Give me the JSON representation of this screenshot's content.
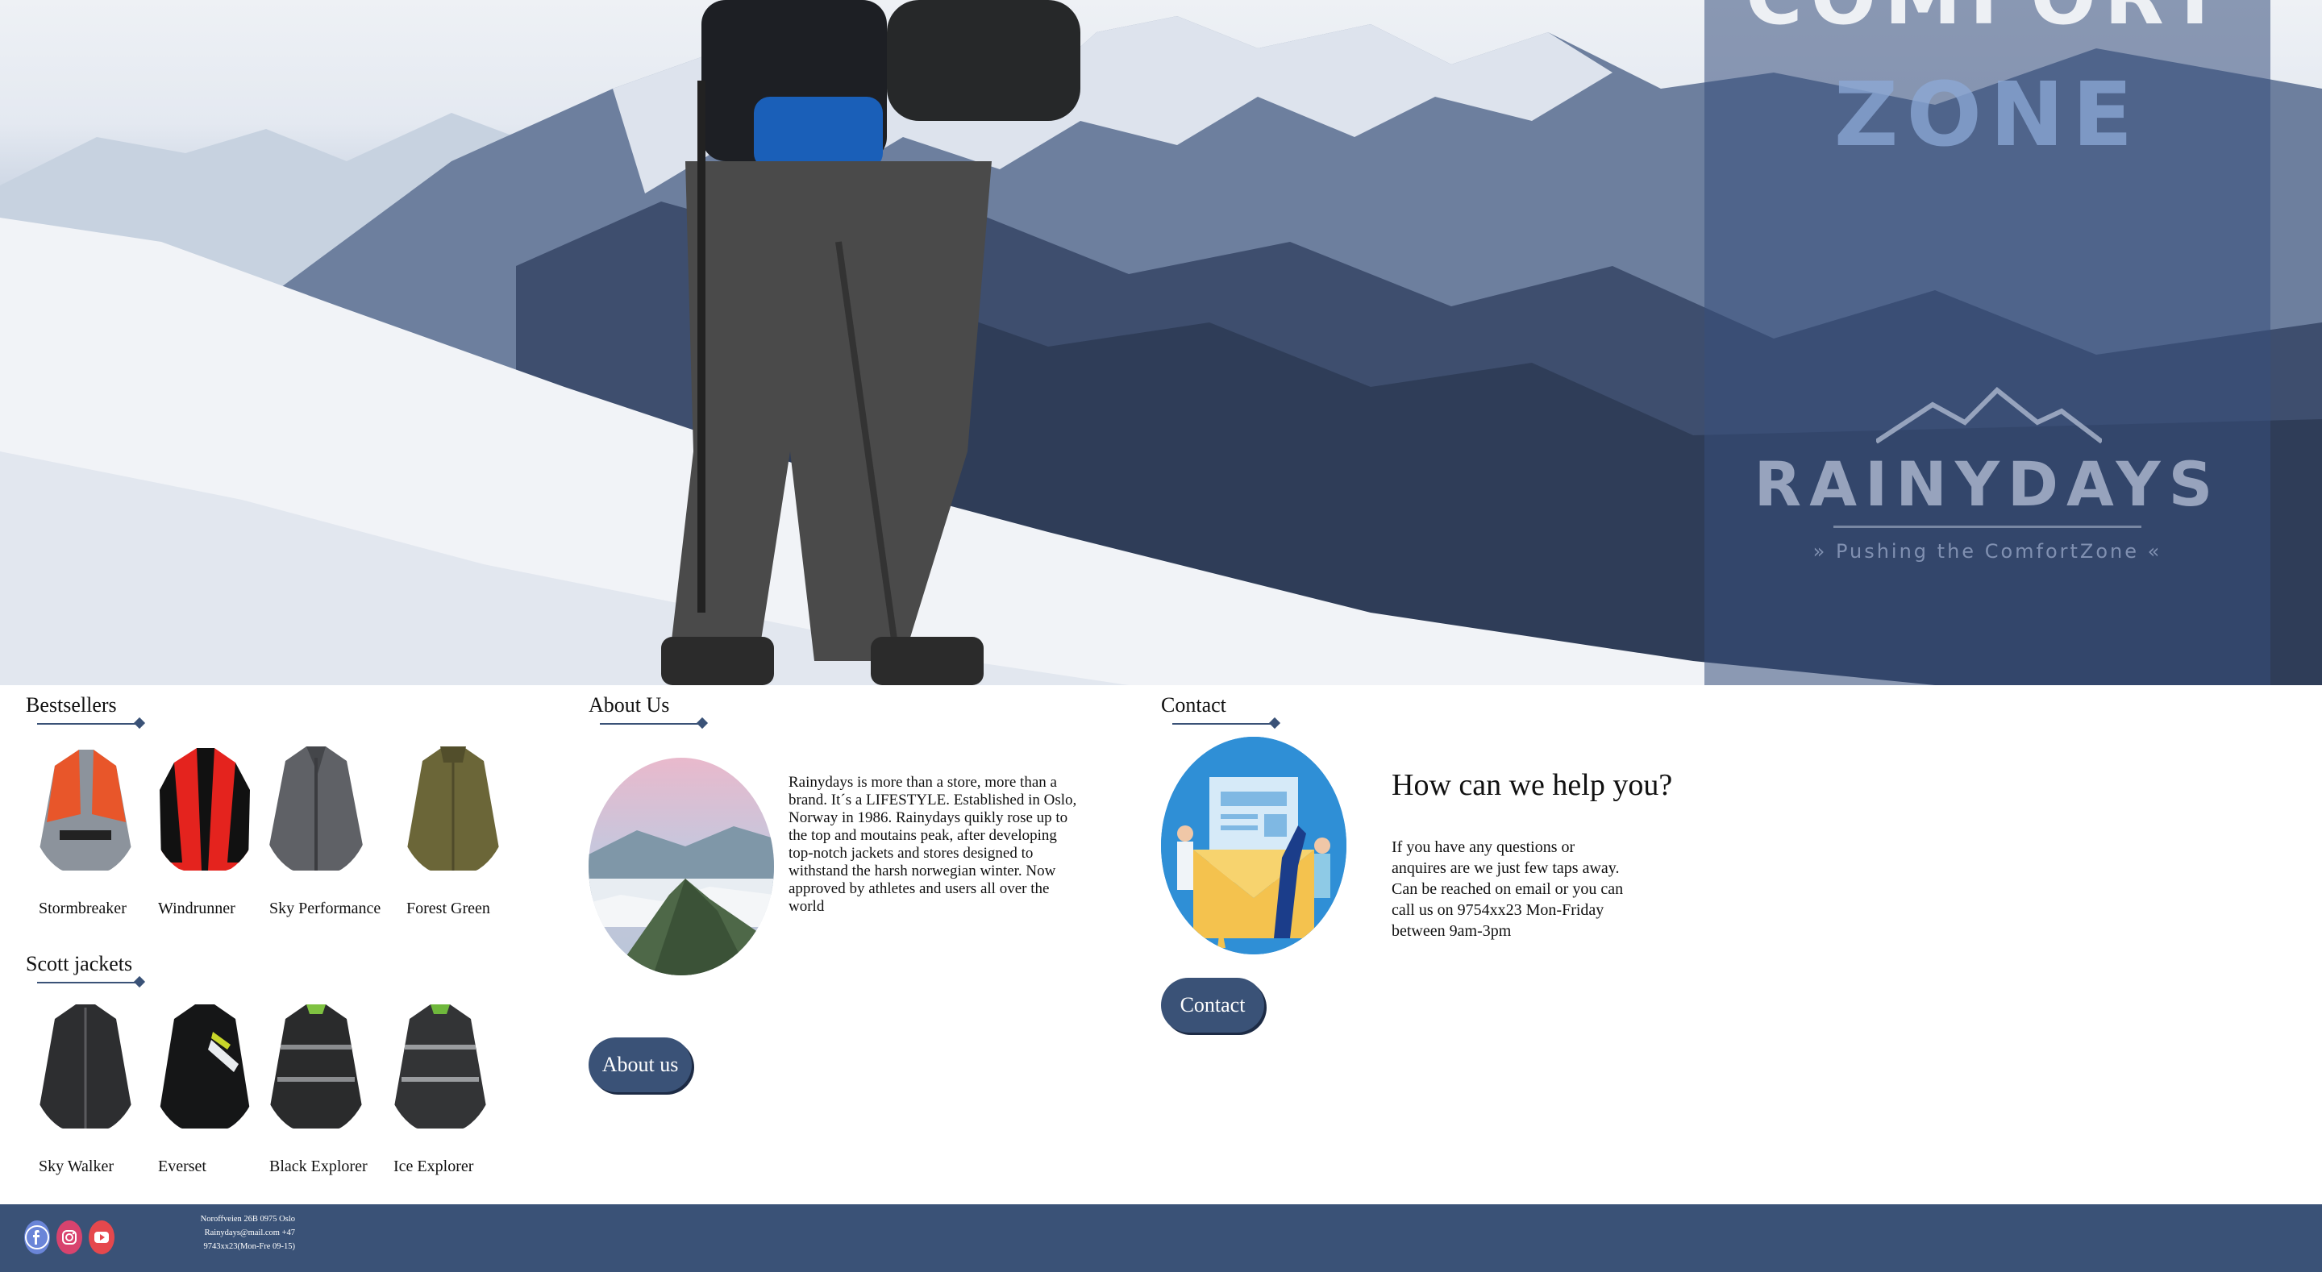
{
  "hero": {
    "panel_line1": "COMFORT",
    "panel_line2": "ZONE",
    "logo_text": "RAINYDAYS",
    "logo_slogan": "» Pushing the ComfortZone «"
  },
  "bestsellers": {
    "title": "Bestsellers",
    "items": [
      {
        "name": "Stormbreaker"
      },
      {
        "name": "Windrunner"
      },
      {
        "name": "Sky Performance"
      },
      {
        "name": "Forest Green"
      }
    ]
  },
  "scott": {
    "title": "Scott jackets",
    "items": [
      {
        "name": "Sky Walker"
      },
      {
        "name": "Everset"
      },
      {
        "name": "Black Explorer"
      },
      {
        "name": "Ice Explorer"
      }
    ]
  },
  "about": {
    "title": "About Us",
    "text": "Rainydays is more than a store, more than a brand. It´s a LIFESTYLE. Established in Oslo, Norway in 1986. Rainydays quikly rose up to the top and moutains peak, after developing top-notch jackets and stores designed to withstand the harsh norwegian winter. Now approved by athletes and users all over the world",
    "button": "About us"
  },
  "contact": {
    "title": "Contact",
    "help_title": "How can we help you?",
    "help_text": "If you have any questions or anquires are we just few taps away. Can be reached on email or you can call us on 9754xx23 Mon-Friday between 9am-3pm",
    "button": "Contact"
  },
  "footer": {
    "social": [
      {
        "icon": "facebook-icon"
      },
      {
        "icon": "instagram-icon"
      },
      {
        "icon": "youtube-icon"
      }
    ],
    "address_line1": "Noroffveien 26B 0975 Oslo",
    "address_line2": "Rainydays@mail.com +47 9743xx23(Mon-Fre 09-15)"
  },
  "colors": {
    "brand": "#3a5277",
    "button_shadow": "#1d2b45",
    "footer": "#3a5277"
  }
}
